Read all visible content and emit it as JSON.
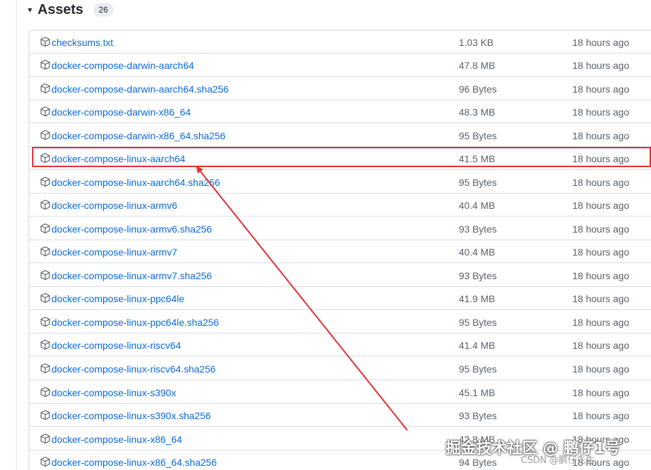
{
  "assets": {
    "caret": "▾",
    "title": "Assets",
    "count": "26",
    "items": [
      {
        "name": "checksums.txt",
        "size": "1.03 KB",
        "time": "18 hours ago"
      },
      {
        "name": "docker-compose-darwin-aarch64",
        "size": "47.8 MB",
        "time": "18 hours ago"
      },
      {
        "name": "docker-compose-darwin-aarch64.sha256",
        "size": "96 Bytes",
        "time": "18 hours ago"
      },
      {
        "name": "docker-compose-darwin-x86_64",
        "size": "48.3 MB",
        "time": "18 hours ago"
      },
      {
        "name": "docker-compose-darwin-x86_64.sha256",
        "size": "95 Bytes",
        "time": "18 hours ago"
      },
      {
        "name": "docker-compose-linux-aarch64",
        "size": "41.5 MB",
        "time": "18 hours ago"
      },
      {
        "name": "docker-compose-linux-aarch64.sha256",
        "size": "95 Bytes",
        "time": "18 hours ago"
      },
      {
        "name": "docker-compose-linux-armv6",
        "size": "40.4 MB",
        "time": "18 hours ago"
      },
      {
        "name": "docker-compose-linux-armv6.sha256",
        "size": "93 Bytes",
        "time": "18 hours ago"
      },
      {
        "name": "docker-compose-linux-armv7",
        "size": "40.4 MB",
        "time": "18 hours ago"
      },
      {
        "name": "docker-compose-linux-armv7.sha256",
        "size": "93 Bytes",
        "time": "18 hours ago"
      },
      {
        "name": "docker-compose-linux-ppc64le",
        "size": "41.9 MB",
        "time": "18 hours ago"
      },
      {
        "name": "docker-compose-linux-ppc64le.sha256",
        "size": "95 Bytes",
        "time": "18 hours ago"
      },
      {
        "name": "docker-compose-linux-riscv64",
        "size": "41.4 MB",
        "time": "18 hours ago"
      },
      {
        "name": "docker-compose-linux-riscv64.sha256",
        "size": "95 Bytes",
        "time": "18 hours ago"
      },
      {
        "name": "docker-compose-linux-s390x",
        "size": "45.1 MB",
        "time": "18 hours ago"
      },
      {
        "name": "docker-compose-linux-s390x.sha256",
        "size": "93 Bytes",
        "time": "18 hours ago"
      },
      {
        "name": "docker-compose-linux-x86_64",
        "size": "42.8 MB",
        "time": "18 hours ago"
      },
      {
        "name": "docker-compose-linux-x86_64.sha256",
        "size": "94 Bytes",
        "time": "18 hours ago"
      }
    ]
  },
  "annotation": {
    "highlight_color": "#e03030",
    "highlighted_item": "docker-compose-linux-aarch64"
  },
  "watermark": {
    "main": "掘金技术社区 @ 鹏仔1号",
    "sub": "CSDN @鹏仔先生"
  },
  "colors": {
    "link": "#0969da",
    "muted": "#57606a",
    "border": "#d0d7de"
  },
  "icons": {
    "caret": "caret-down-icon",
    "package": "package-icon"
  }
}
